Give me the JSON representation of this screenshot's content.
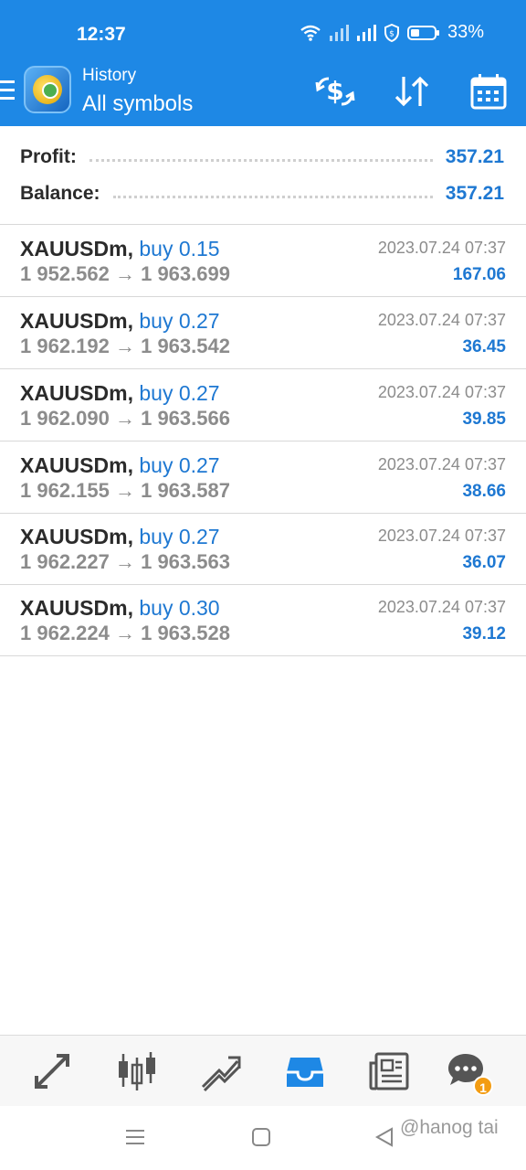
{
  "status": {
    "time": "12:37",
    "battery": "33%"
  },
  "header": {
    "subtitle": "History",
    "title": "All symbols",
    "icons": [
      "menu-icon",
      "app-logo",
      "currency-exchange-icon",
      "sort-icon",
      "calendar-icon"
    ]
  },
  "summary": {
    "profit_label": "Profit:",
    "profit_value": "357.21",
    "balance_label": "Balance:",
    "balance_value": "357.21"
  },
  "deals": [
    {
      "symbol": "XAUUSDm,",
      "side": "buy 0.15",
      "prices": "1 952.562 → 1 963.699",
      "datetime": "2023.07.24 07:37",
      "profit": "167.06"
    },
    {
      "symbol": "XAUUSDm,",
      "side": "buy 0.27",
      "prices": "1 962.192 → 1 963.542",
      "datetime": "2023.07.24 07:37",
      "profit": "36.45"
    },
    {
      "symbol": "XAUUSDm,",
      "side": "buy 0.27",
      "prices": "1 962.090 → 1 963.566",
      "datetime": "2023.07.24 07:37",
      "profit": "39.85"
    },
    {
      "symbol": "XAUUSDm,",
      "side": "buy 0.27",
      "prices": "1 962.155 → 1 963.587",
      "datetime": "2023.07.24 07:37",
      "profit": "38.66"
    },
    {
      "symbol": "XAUUSDm,",
      "side": "buy 0.27",
      "prices": "1 962.227 → 1 963.563",
      "datetime": "2023.07.24 07:37",
      "profit": "36.07"
    },
    {
      "symbol": "XAUUSDm,",
      "side": "buy 0.30",
      "prices": "1 962.224 → 1 963.528",
      "datetime": "2023.07.24 07:37",
      "profit": "39.12"
    }
  ],
  "tabbar": {
    "items": [
      "quotes-icon",
      "chart-icon",
      "trade-icon",
      "history-icon",
      "news-icon",
      "messages-icon"
    ],
    "active": "history-icon",
    "messages_badge": "1"
  },
  "watermark": "@hanog tai",
  "colors": {
    "primary": "#1e88e5",
    "accent_text": "#1e78d2",
    "badge": "#f39c12"
  }
}
